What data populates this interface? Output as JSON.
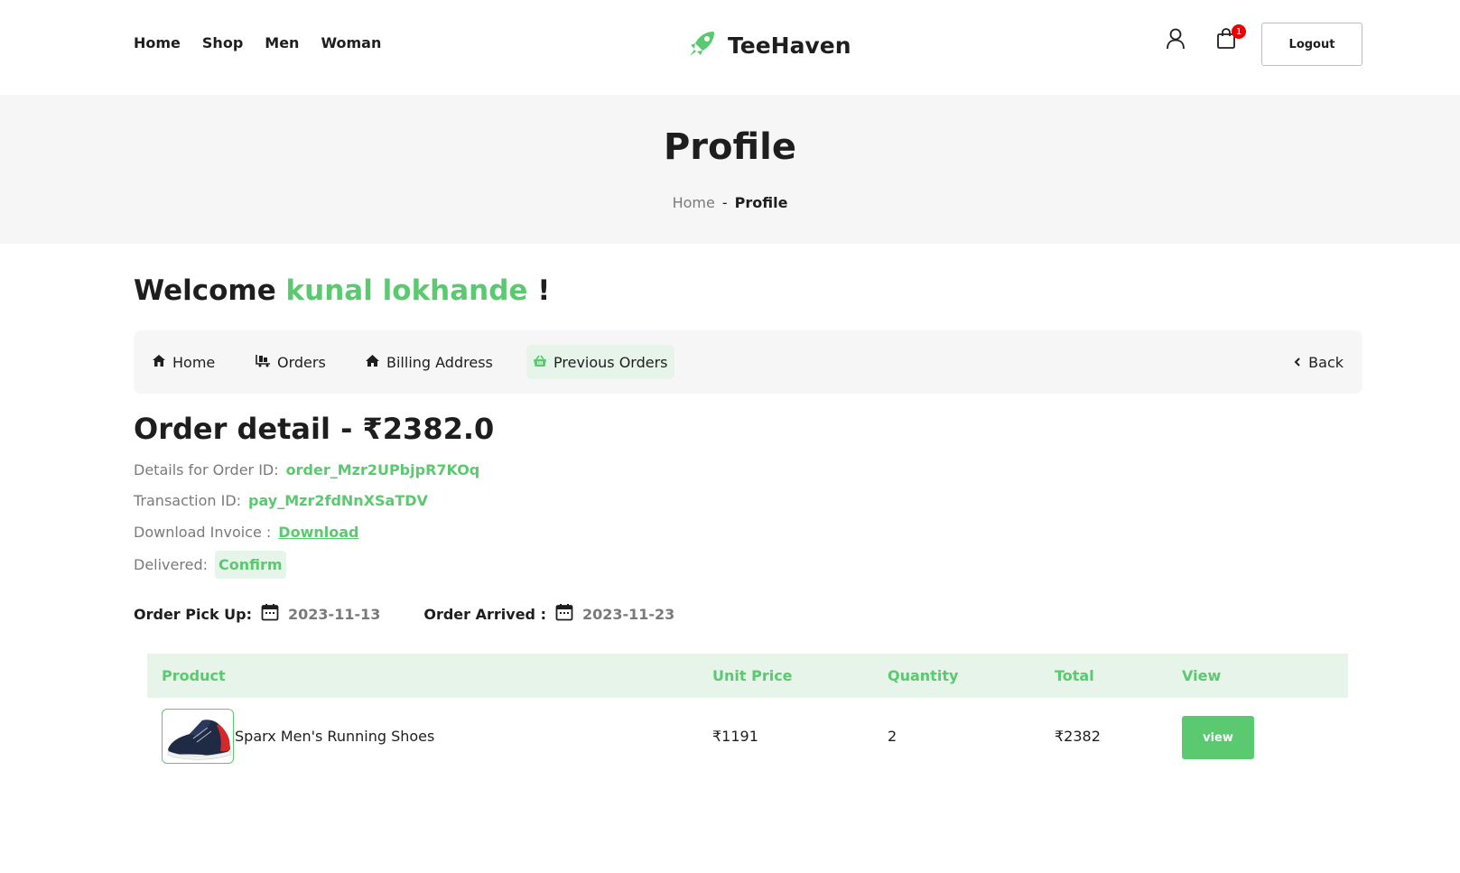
{
  "header": {
    "nav": [
      "Home",
      "Shop",
      "Men",
      "Woman"
    ],
    "brand": "TeeHaven",
    "cart_count": "1",
    "logout_label": "Logout"
  },
  "banner": {
    "title": "Profile",
    "breadcrumb_home": "Home",
    "breadcrumb_sep": "-",
    "breadcrumb_current": "Profile"
  },
  "welcome": {
    "prefix": "Welcome",
    "username": "kunal lokhande",
    "suffix": "!"
  },
  "tabs": {
    "home": "Home",
    "orders": "Orders",
    "billing": "Billing Address",
    "previous": "Previous Orders",
    "back": "Back"
  },
  "order": {
    "title": "Order detail - ₹2382.0",
    "order_id_label": "Details for Order ID:",
    "order_id": "order_Mzr2UPbjpR7KOq",
    "txn_label": "Transaction ID:",
    "txn_id": "pay_Mzr2fdNnXSaTDV",
    "invoice_label": "Download Invoice :",
    "invoice_link": "Download",
    "delivered_label": "Delivered:",
    "confirm_label": "Confirm",
    "pickup_label": "Order Pick Up:",
    "pickup_date": "2023-11-13",
    "arrived_label": "Order Arrived :",
    "arrived_date": "2023-11-23"
  },
  "table": {
    "headers": [
      "Product",
      "Unit Price",
      "Quantity",
      "Total",
      "View"
    ],
    "rows": [
      {
        "product": "Sparx Men's Running Shoes",
        "unit_price": "₹1191",
        "quantity": "2",
        "total": "₹2382",
        "view_label": "view"
      }
    ]
  },
  "colors": {
    "accent": "#5ac96f",
    "accent_light": "#e6f4ea",
    "badge": "#ee0000",
    "text": "#1e1e1e",
    "muted": "#7a7a7a"
  }
}
